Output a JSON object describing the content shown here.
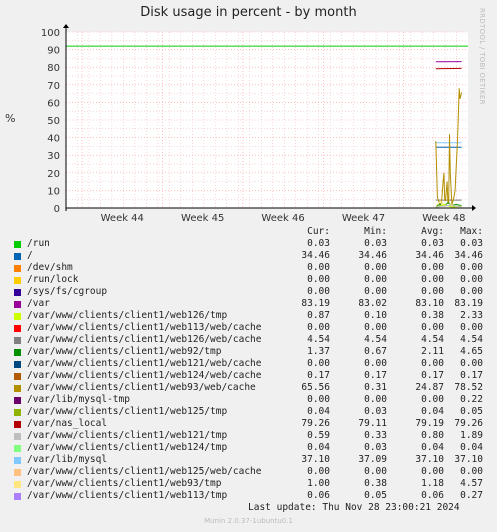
{
  "title": "Disk usage in percent - by month",
  "side_label": "RRDTOOL / TOBI OETIKER",
  "last_update": "Last update: Thu Nov 28 23:00:21 2024",
  "footer": "Munin 2.0.37-1ubuntu0.1",
  "colors": {
    "background": "#f0f0f0",
    "plot": "#ffffff",
    "grid": "#ff9999",
    "axis": "#000000"
  },
  "legend": {
    "headers": [
      "Cur:",
      "Min:",
      "Avg:",
      "Max:"
    ],
    "rows": [
      {
        "name": "/run",
        "color": "#00cc00",
        "cur": "0.03",
        "min": "0.03",
        "avg": "0.03",
        "max": "0.03"
      },
      {
        "name": "/",
        "color": "#0066b3",
        "cur": "34.46",
        "min": "34.46",
        "avg": "34.46",
        "max": "34.46"
      },
      {
        "name": "/dev/shm",
        "color": "#ff8000",
        "cur": "0.00",
        "min": "0.00",
        "avg": "0.00",
        "max": "0.00"
      },
      {
        "name": "/run/lock",
        "color": "#ffcc00",
        "cur": "0.00",
        "min": "0.00",
        "avg": "0.00",
        "max": "0.00"
      },
      {
        "name": "/sys/fs/cgroup",
        "color": "#330099",
        "cur": "0.00",
        "min": "0.00",
        "avg": "0.00",
        "max": "0.00"
      },
      {
        "name": "/var",
        "color": "#990099",
        "cur": "83.19",
        "min": "83.02",
        "avg": "83.10",
        "max": "83.19"
      },
      {
        "name": "/var/www/clients/client1/web126/tmp",
        "color": "#ccff00",
        "cur": "0.87",
        "min": "0.10",
        "avg": "0.38",
        "max": "2.33"
      },
      {
        "name": "/var/www/clients/client1/web113/web/cache",
        "color": "#ff0000",
        "cur": "0.00",
        "min": "0.00",
        "avg": "0.00",
        "max": "0.00"
      },
      {
        "name": "/var/www/clients/client1/web126/web/cache",
        "color": "#808080",
        "cur": "4.54",
        "min": "4.54",
        "avg": "4.54",
        "max": "4.54"
      },
      {
        "name": "/var/www/clients/client1/web92/tmp",
        "color": "#008f00",
        "cur": "1.37",
        "min": "0.67",
        "avg": "2.11",
        "max": "4.65"
      },
      {
        "name": "/var/www/clients/client1/web121/web/cache",
        "color": "#00487d",
        "cur": "0.00",
        "min": "0.00",
        "avg": "0.00",
        "max": "0.00"
      },
      {
        "name": "/var/www/clients/client1/web124/web/cache",
        "color": "#b35a00",
        "cur": "0.17",
        "min": "0.17",
        "avg": "0.17",
        "max": "0.17"
      },
      {
        "name": "/var/www/clients/client1/web93/web/cache",
        "color": "#b38f00",
        "cur": "65.56",
        "min": "0.31",
        "avg": "24.87",
        "max": "78.52"
      },
      {
        "name": "/var/lib/mysql-tmp",
        "color": "#6b006b",
        "cur": "0.00",
        "min": "0.00",
        "avg": "0.00",
        "max": "0.22"
      },
      {
        "name": "/var/www/clients/client1/web125/tmp",
        "color": "#8fb300",
        "cur": "0.04",
        "min": "0.03",
        "avg": "0.04",
        "max": "0.05"
      },
      {
        "name": "/var/nas_local",
        "color": "#b30000",
        "cur": "79.26",
        "min": "79.11",
        "avg": "79.19",
        "max": "79.26"
      },
      {
        "name": "/var/www/clients/client1/web121/tmp",
        "color": "#bebebe",
        "cur": "0.59",
        "min": "0.33",
        "avg": "0.80",
        "max": "1.89"
      },
      {
        "name": "/var/www/clients/client1/web124/tmp",
        "color": "#80ff80",
        "cur": "0.04",
        "min": "0.03",
        "avg": "0.04",
        "max": "0.04"
      },
      {
        "name": "/var/lib/mysql",
        "color": "#80c9ff",
        "cur": "37.10",
        "min": "37.09",
        "avg": "37.10",
        "max": "37.10"
      },
      {
        "name": "/var/www/clients/client1/web125/web/cache",
        "color": "#ffc080",
        "cur": "0.00",
        "min": "0.00",
        "avg": "0.00",
        "max": "0.00"
      },
      {
        "name": "/var/www/clients/client1/web93/tmp",
        "color": "#ffe680",
        "cur": "1.00",
        "min": "0.38",
        "avg": "1.18",
        "max": "4.57"
      },
      {
        "name": "/var/www/clients/client1/web113/tmp",
        "color": "#aa80ff",
        "cur": "0.06",
        "min": "0.05",
        "avg": "0.06",
        "max": "0.27"
      }
    ]
  },
  "chart_data": {
    "type": "line",
    "title": "Disk usage in percent - by month",
    "ylabel": "%",
    "ylim": [
      0,
      100
    ],
    "yticks": [
      0,
      10,
      20,
      30,
      40,
      50,
      60,
      70,
      80,
      90,
      100
    ],
    "xlim": [
      43.3,
      48.3
    ],
    "xticks": [
      {
        "label": "Week 44",
        "value": 44
      },
      {
        "label": "Week 45",
        "value": 45
      },
      {
        "label": "Week 46",
        "value": 46
      },
      {
        "label": "Week 47",
        "value": 47
      },
      {
        "label": "Week 48",
        "value": 48
      }
    ],
    "threshold": {
      "value": 92,
      "color": "#00cc00"
    },
    "series": [
      {
        "name": "/var",
        "color": "#990099",
        "points": [
          [
            47.9,
            83.1
          ],
          [
            48.22,
            83.2
          ]
        ]
      },
      {
        "name": "/var/nas_local",
        "color": "#b30000",
        "points": [
          [
            47.9,
            79.1
          ],
          [
            48.22,
            79.3
          ]
        ]
      },
      {
        "name": "/var/lib/mysql",
        "color": "#80c9ff",
        "points": [
          [
            47.9,
            37.1
          ],
          [
            48.22,
            37.1
          ]
        ]
      },
      {
        "name": "/",
        "color": "#0066b3",
        "points": [
          [
            47.9,
            34.5
          ],
          [
            48.22,
            34.5
          ]
        ]
      },
      {
        "name": "/var/www/clients/client1/web126/web/cache",
        "color": "#808080",
        "points": [
          [
            47.9,
            4.5
          ],
          [
            48.22,
            4.5
          ]
        ]
      },
      {
        "name": "/var/www/clients/client1/web93/web/cache",
        "color": "#b38f00",
        "points": [
          [
            47.9,
            38
          ],
          [
            47.92,
            6
          ],
          [
            47.95,
            2
          ],
          [
            47.97,
            3
          ],
          [
            47.99,
            15
          ],
          [
            48.0,
            20
          ],
          [
            48.01,
            5
          ],
          [
            48.02,
            4
          ],
          [
            48.04,
            15
          ],
          [
            48.05,
            3
          ],
          [
            48.06,
            3
          ],
          [
            48.07,
            42
          ],
          [
            48.08,
            20
          ],
          [
            48.1,
            2
          ],
          [
            48.12,
            5
          ],
          [
            48.14,
            10
          ],
          [
            48.15,
            20
          ],
          [
            48.17,
            38
          ],
          [
            48.19,
            68
          ],
          [
            48.2,
            62
          ],
          [
            48.22,
            65.6
          ]
        ]
      },
      {
        "name": "/var/www/clients/client1/web92/tmp",
        "color": "#008f00",
        "points": [
          [
            47.9,
            1
          ],
          [
            47.95,
            2
          ],
          [
            48.0,
            1
          ],
          [
            48.05,
            3
          ],
          [
            48.1,
            1.5
          ],
          [
            48.15,
            2
          ],
          [
            48.22,
            1.4
          ]
        ]
      },
      {
        "name": "/var/www/clients/client1/web93/tmp",
        "color": "#ffe680",
        "points": [
          [
            47.9,
            1
          ],
          [
            47.96,
            4
          ],
          [
            48.02,
            1
          ],
          [
            48.08,
            2
          ],
          [
            48.14,
            1
          ],
          [
            48.22,
            1
          ]
        ]
      },
      {
        "name": "/var/www/clients/client1/web126/tmp",
        "color": "#ccff00",
        "points": [
          [
            47.9,
            0.3
          ],
          [
            48.0,
            2
          ],
          [
            48.1,
            0.5
          ],
          [
            48.22,
            0.9
          ]
        ]
      },
      {
        "name": "/var/www/clients/client1/web121/tmp",
        "color": "#bebebe",
        "points": [
          [
            47.9,
            0.5
          ],
          [
            48.05,
            1.5
          ],
          [
            48.22,
            0.6
          ]
        ]
      }
    ]
  }
}
